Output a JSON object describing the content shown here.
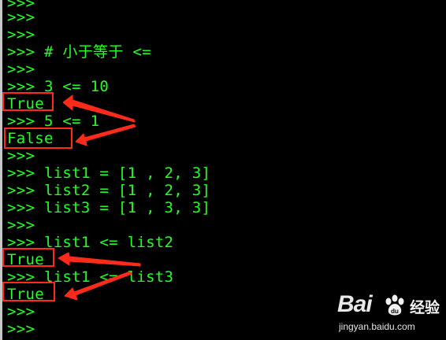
{
  "console": {
    "lines": [
      ">>>",
      ">>>",
      ">>>",
      ">>> # 小于等于 <=",
      ">>>",
      ">>> 3 <= 10",
      "True",
      ">>> 5 <= 1",
      "False",
      ">>>",
      ">>> list1 = [1 , 2, 3]",
      ">>> list2 = [1 , 2, 3]",
      ">>> list3 = [1 , 3, 3]",
      ">>>",
      ">>> list1 <= list2",
      "True",
      ">>> list1 <= list3",
      "True",
      ">>>",
      ">>>"
    ]
  },
  "colors": {
    "background": "#000000",
    "text": "#22ff22",
    "annotation": "#ff2a1a"
  },
  "watermark": {
    "logo": "Bai",
    "brand": "经验",
    "url": "jingyan.baidu.com"
  }
}
